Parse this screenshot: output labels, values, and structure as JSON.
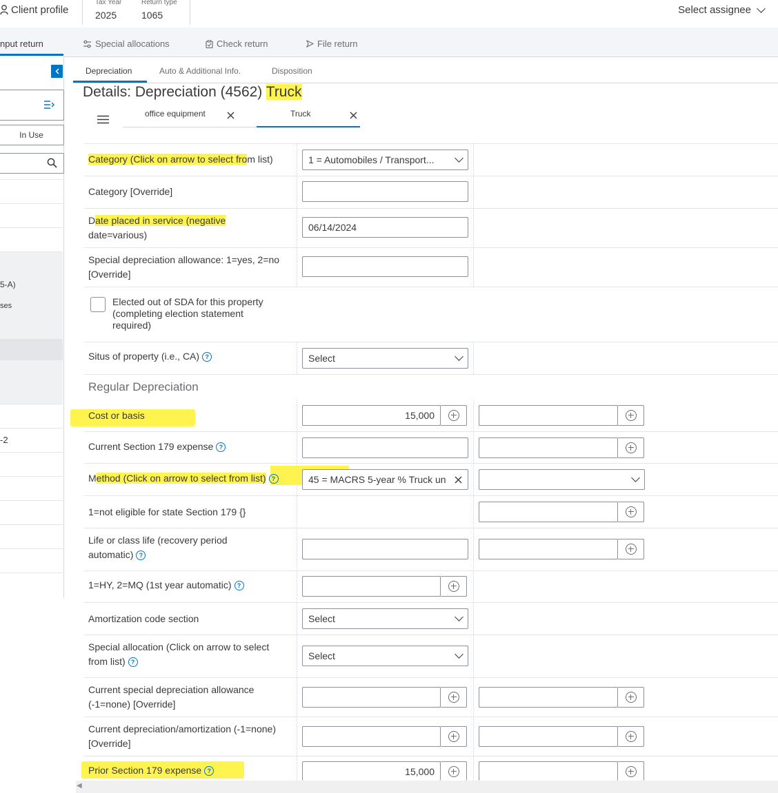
{
  "header": {
    "client_profile": "Client profile",
    "tax_year_label": "Tax Year",
    "tax_year": "2025",
    "return_type_label": "Return type",
    "return_type": "1065",
    "assignee": "Select assignee"
  },
  "nav": {
    "input_return": "nput return",
    "special_allocations": "Special allocations",
    "check_return": "Check return",
    "file_return": "File return"
  },
  "left_panel": {
    "in_use": "In Use",
    "partial_1": "5-A)",
    "partial_2": "ses",
    "partial_3": "-2"
  },
  "subtabs": {
    "depreciation": "Depreciation",
    "auto": "Auto & Additional Info.",
    "disposition": "Disposition"
  },
  "title": {
    "prefix": "Details: Depreciation (4562)",
    "asset": "Truck"
  },
  "asset_tabs": {
    "tab1": "office equipment",
    "tab2": "Truck"
  },
  "form": {
    "category_label_hl": "Category (Click on arrow to select fro",
    "category_label_rest": "m list)",
    "category_value": "1 = Automobiles / Transport...",
    "category_override_label": "Category [Override]",
    "date_label_1": "D",
    "date_label_hl": "ate placed in service (negative",
    "date_label_2": "date=various)",
    "date_value": "06/14/2024",
    "sda_label": "Special depreciation allowance: 1=yes, 2=no [Override]",
    "elected_label": "Elected out of SDA for this property (completing election statement required)",
    "situs_label": "Situs of property (i.e., CA)",
    "situs_value": "Select",
    "regular_heading": "Regular Depreciation",
    "cost_label": "Cost or basis",
    "cost_value": "15,000",
    "sec179_label": "Current Section 179 expense",
    "method_label_1": "M",
    "method_label_hl": "ethod (Click on arrow to select from list)",
    "method_value": "45 = MACRS 5-year % Truck un",
    "state179_label": "1=not eligible for state Section 179 {}",
    "life_label": "Life or class life (recovery period automatic)",
    "hy_label": "1=HY, 2=MQ (1st year automatic)",
    "amort_label": "Amortization code section",
    "amort_value": "Select",
    "special_alloc_label": "Special allocation (Click on arrow to select from list)",
    "special_alloc_value": "Select",
    "current_sda_label": "Current special depreciation allowance (-1=none) [Override]",
    "current_dep_label": "Current depreciation/amortization (-1=none) [Override]",
    "prior179_label": "Prior Section 179 expense",
    "prior179_value": "15,000"
  },
  "colors": {
    "accent": "#0077c5",
    "highlight": "#fff44f"
  }
}
